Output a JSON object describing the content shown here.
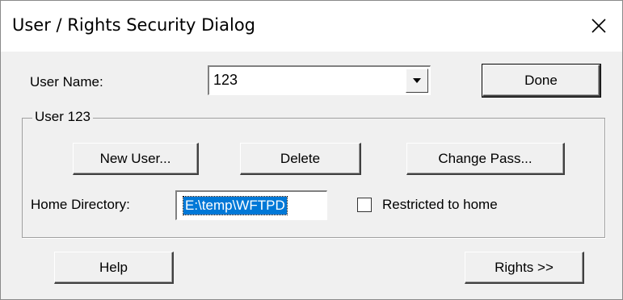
{
  "window": {
    "title": "User / Rights Security Dialog",
    "close_icon": "close-icon"
  },
  "user_name": {
    "label": "User Name:",
    "value": "123",
    "arrow_icon": "chevron-down-icon"
  },
  "done_label": "Done",
  "group": {
    "label": "User 123",
    "new_user_label": "New User...",
    "delete_label": "Delete",
    "change_pass_label": "Change Pass...",
    "home_dir_label": "Home Directory:",
    "home_dir_value": "E:\\temp\\WFTPD",
    "restricted_label": "Restricted to home",
    "restricted_checked": false
  },
  "help_label": "Help",
  "rights_label": "Rights >>"
}
